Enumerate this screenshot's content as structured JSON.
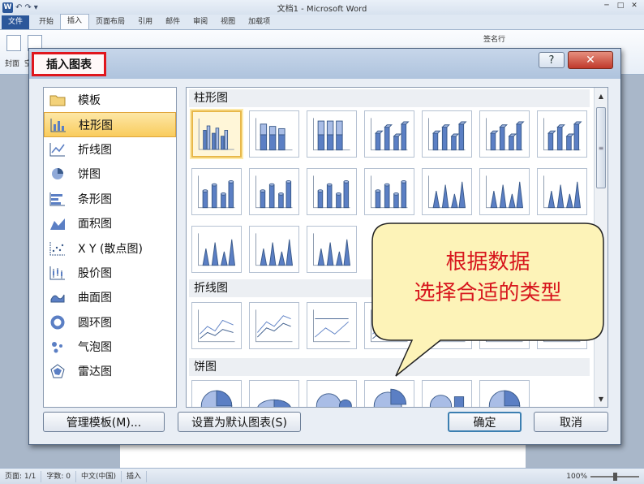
{
  "window": {
    "title": "文档1 - Microsoft Word",
    "qat_icon": "W",
    "qat_items": [
      "↶",
      "↷",
      "▾"
    ],
    "controls": [
      "─",
      "□",
      "✕"
    ]
  },
  "ribbon": {
    "tabs": [
      "文件",
      "开始",
      "插入",
      "页面布局",
      "引用",
      "邮件",
      "审阅",
      "视图",
      "加载项"
    ],
    "active_tab": "插入",
    "labels": {
      "cover": "封面",
      "cover_more": "空",
      "signature": "签名行"
    }
  },
  "dialog": {
    "title": "插入图表",
    "help": "?",
    "close": "✕",
    "chart_types": [
      {
        "label": "模板",
        "icon": "folder-icon",
        "selected": false
      },
      {
        "label": "柱形图",
        "icon": "column-chart-icon",
        "selected": true
      },
      {
        "label": "折线图",
        "icon": "line-chart-icon",
        "selected": false
      },
      {
        "label": "饼图",
        "icon": "pie-chart-icon",
        "selected": false
      },
      {
        "label": "条形图",
        "icon": "bar-chart-icon",
        "selected": false
      },
      {
        "label": "面积图",
        "icon": "area-chart-icon",
        "selected": false
      },
      {
        "label": "X Y (散点图)",
        "icon": "scatter-chart-icon",
        "selected": false
      },
      {
        "label": "股价图",
        "icon": "stock-chart-icon",
        "selected": false
      },
      {
        "label": "曲面图",
        "icon": "surface-chart-icon",
        "selected": false
      },
      {
        "label": "圆环图",
        "icon": "doughnut-chart-icon",
        "selected": false
      },
      {
        "label": "气泡图",
        "icon": "bubble-chart-icon",
        "selected": false
      },
      {
        "label": "雷达图",
        "icon": "radar-chart-icon",
        "selected": false
      }
    ],
    "groups": {
      "column": "柱形图",
      "line": "折线图",
      "pie": "饼图"
    },
    "buttons": {
      "manage_templates": "管理模板(M)...",
      "set_default": "设置为默认图表(S)",
      "ok": "确定",
      "cancel": "取消"
    }
  },
  "callout": {
    "line1": "根据数据",
    "line2": "选择合适的类型"
  },
  "statusbar": {
    "page": "页面: 1/1",
    "words": "字数: 0",
    "language": "中文(中国)",
    "mode": "插入",
    "zoom": "100%"
  },
  "colors": {
    "highlight": "#e0161d",
    "callout_fill": "#fdf3b8",
    "selected_item": "#f9cc5d",
    "chart_blue": "#5b7fc4"
  }
}
